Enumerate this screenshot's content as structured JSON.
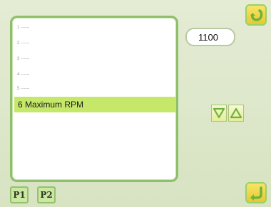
{
  "list": {
    "items": [
      {
        "num": "1",
        "label": "------"
      },
      {
        "num": "2",
        "label": "------"
      },
      {
        "num": "3",
        "label": "------"
      },
      {
        "num": "4",
        "label": "------"
      },
      {
        "num": "5",
        "label": "------"
      },
      {
        "num": "6",
        "label": "Maximum RPM"
      }
    ],
    "selected_label": "6 Maximum RPM"
  },
  "value": "1100",
  "tabs": [
    "P1",
    "P2"
  ],
  "icons": {
    "top_right": "return-arrow-icon",
    "bottom_right": "enter-icon",
    "down": "arrow-down-icon",
    "up": "arrow-up-icon"
  },
  "colors": {
    "highlight": "#c6e86a",
    "panel_border": "#8fbf6a",
    "button_yellow": "#e5c933"
  }
}
